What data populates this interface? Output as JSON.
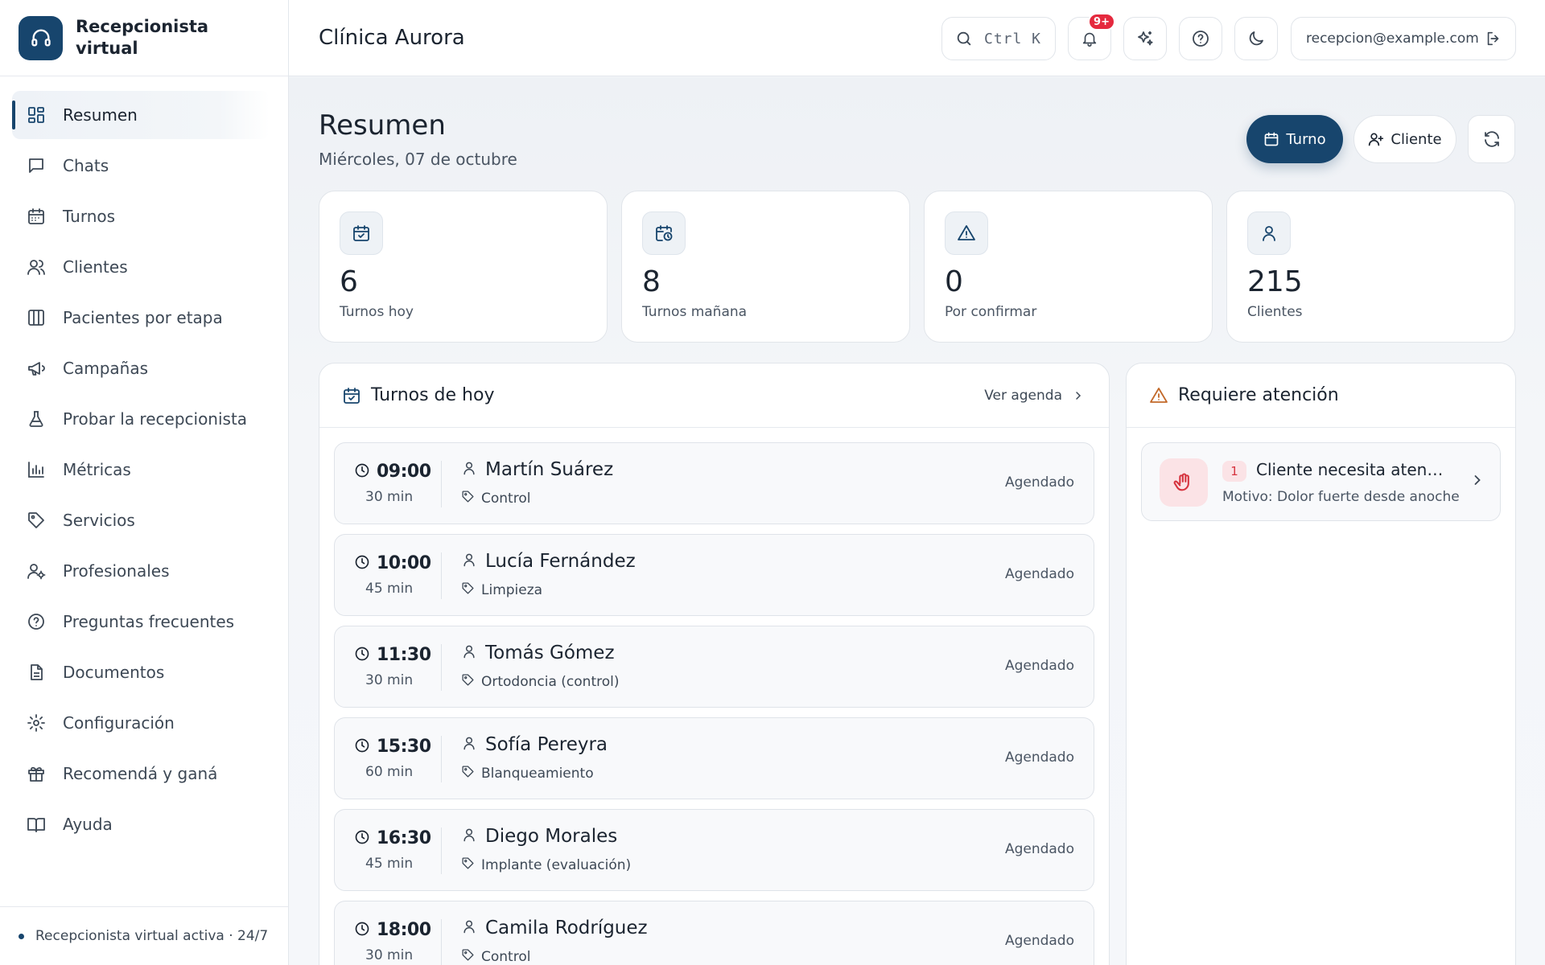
{
  "brand": {
    "name": "Recepcionista virtual"
  },
  "sidebar": {
    "items": [
      {
        "label": "Resumen",
        "icon": "dashboard-icon",
        "active": true
      },
      {
        "label": "Chats",
        "icon": "chat-icon"
      },
      {
        "label": "Turnos",
        "icon": "calendar-icon"
      },
      {
        "label": "Clientes",
        "icon": "users-icon"
      },
      {
        "label": "Pacientes por etapa",
        "icon": "kanban-icon"
      },
      {
        "label": "Campañas",
        "icon": "megaphone-icon"
      },
      {
        "label": "Probar la recepcionista",
        "icon": "flask-icon"
      },
      {
        "label": "Métricas",
        "icon": "bar-chart-icon"
      },
      {
        "label": "Servicios",
        "icon": "tag-icon"
      },
      {
        "label": "Profesionales",
        "icon": "user-gear-icon"
      },
      {
        "label": "Preguntas frecuentes",
        "icon": "help-circle-icon"
      },
      {
        "label": "Documentos",
        "icon": "document-icon"
      },
      {
        "label": "Configuración",
        "icon": "gear-icon"
      },
      {
        "label": "Recomendá y ganá",
        "icon": "gift-icon"
      },
      {
        "label": "Ayuda",
        "icon": "book-icon"
      }
    ],
    "footer": "Recepcionista virtual activa · 24/7"
  },
  "topbar": {
    "clinic_name": "Clínica Aurora",
    "search_shortcut": "Ctrl K",
    "notifications_badge": "9+",
    "user_email": "recepcion@example.com"
  },
  "page": {
    "title": "Resumen",
    "date": "Miércoles, 07 de octubre",
    "actions": {
      "new_appointment": "Turno",
      "new_client": "Cliente"
    }
  },
  "stats": [
    {
      "value": "6",
      "label": "Turnos hoy",
      "icon": "calendar-check-icon"
    },
    {
      "value": "8",
      "label": "Turnos mañana",
      "icon": "calendar-clock-icon"
    },
    {
      "value": "0",
      "label": "Por confirmar",
      "icon": "warning-icon"
    },
    {
      "value": "215",
      "label": "Clientes",
      "icon": "user-icon"
    }
  ],
  "today": {
    "title": "Turnos de hoy",
    "view_agenda": "Ver agenda",
    "appointments": [
      {
        "time": "09:00",
        "duration": "30 min",
        "name": "Martín Suárez",
        "service": "Control",
        "status": "Agendado"
      },
      {
        "time": "10:00",
        "duration": "45 min",
        "name": "Lucía Fernández",
        "service": "Limpieza",
        "status": "Agendado"
      },
      {
        "time": "11:30",
        "duration": "30 min",
        "name": "Tomás Gómez",
        "service": "Ortodoncia (control)",
        "status": "Agendado"
      },
      {
        "time": "15:30",
        "duration": "60 min",
        "name": "Sofía Pereyra",
        "service": "Blanqueamiento",
        "status": "Agendado"
      },
      {
        "time": "16:30",
        "duration": "45 min",
        "name": "Diego Morales",
        "service": "Implante (evaluación)",
        "status": "Agendado"
      },
      {
        "time": "18:00",
        "duration": "30 min",
        "name": "Camila Rodríguez",
        "service": "Control",
        "status": "Agendado"
      }
    ]
  },
  "attention": {
    "title": "Requiere atención",
    "items": [
      {
        "count": "1",
        "title": "Cliente necesita atención",
        "reason": "Motivo: Dolor fuerte desde anoche"
      }
    ]
  },
  "colors": {
    "primary": "#17456d",
    "alert": "#e5293e",
    "warning": "#c2692a"
  }
}
